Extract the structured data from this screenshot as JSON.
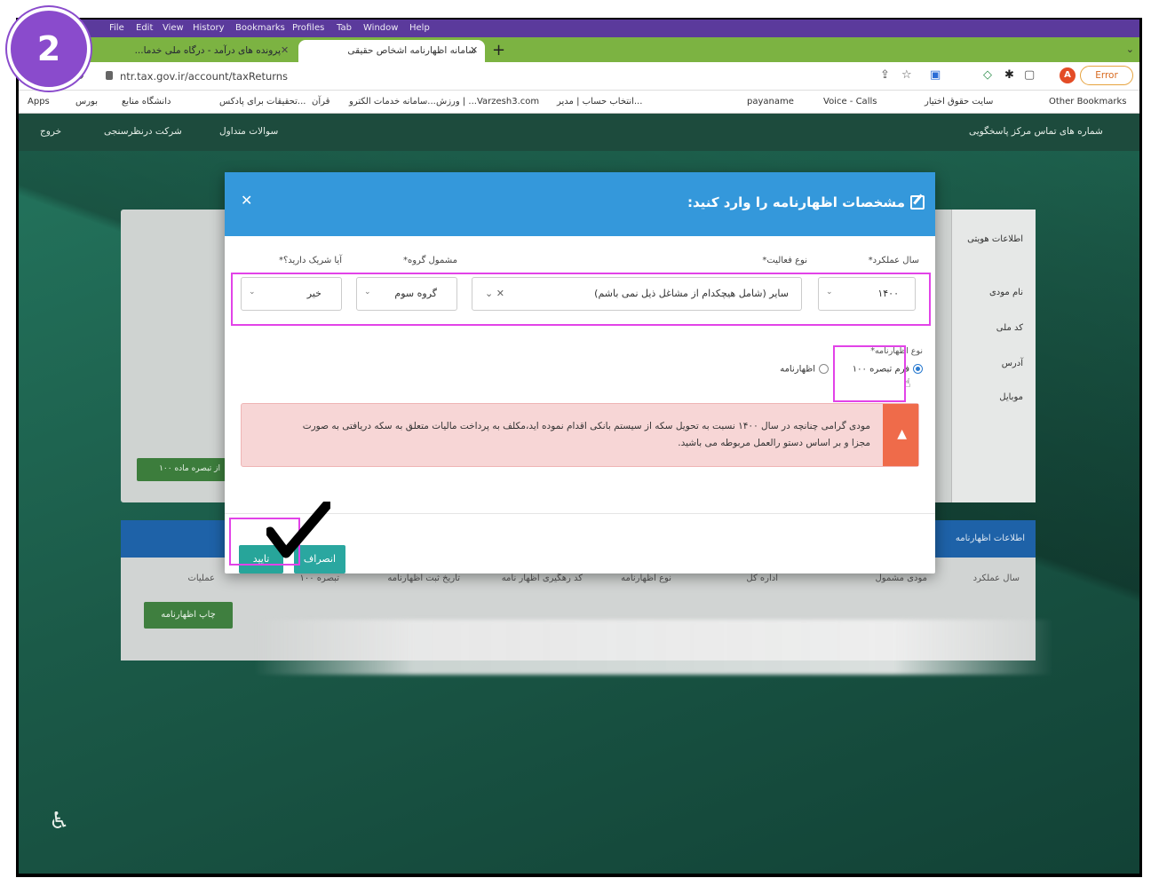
{
  "step_badge": "2",
  "menubar": {
    "items": [
      "File",
      "Edit",
      "View",
      "History",
      "Bookmarks",
      "Profiles",
      "Tab",
      "Window",
      "Help"
    ]
  },
  "tabs": [
    {
      "label": "پرونده های درآمد - درگاه ملی خدما...",
      "active": false
    },
    {
      "label": "سامانه اظهارنامه اشخاص حقیقی",
      "active": true
    }
  ],
  "address_bar": {
    "url": "ntr.tax.gov.ir/account/taxReturns",
    "error_label": "Error",
    "avatar_letter": "A"
  },
  "bookmarks": [
    "Apps",
    "بورس",
    "دانشگاه منابع",
    "تحقیقات برای پادکس...",
    "قرآن",
    "سامانه خدمات الکترو...",
    "ورزش | ...Varzesh3.com",
    "انتخاب حساب | مدیر...",
    "payaname",
    "Voice - Calls",
    "سایت حقوق اختیار",
    "Other Bookmarks"
  ],
  "site_header": {
    "exit": "خروج",
    "survey": "شرکت درنظرسنجی",
    "faq": "سوالات متداول",
    "support": "شماره های تماس مرکز پاسخگویی"
  },
  "background": {
    "side_items": [
      "اطلاعات هویتی",
      "نام مودی",
      "کد ملی",
      "آدرس",
      "موبایل"
    ],
    "green_button": "از تبصره ماده ۱۰۰",
    "declarations_header": "اطلاعات اظهارنامه",
    "columns": [
      "سال عملکرد",
      "مودی مشمول",
      "اداره کل",
      "نوع اظهارنامه",
      "کد رهگیری اظهار نامه",
      "تاریخ ثبت اظهارنامه",
      "تبصره ۱۰۰",
      "عملیات"
    ],
    "print_button": "چاپ اظهارنامه"
  },
  "modal": {
    "title": "مشخصات اظهارنامه را وارد کنید:",
    "fields": {
      "year_label": "سال عملکرد*",
      "year_value": "۱۴۰۰",
      "activity_label": "نوع فعالیت*",
      "activity_value": "سایر (شامل هیچکدام از مشاغل ذیل نمی باشم)",
      "group_label": "مشمول گروه*",
      "group_value": "گروه سوم",
      "partner_label": "آیا شریک دارید؟*",
      "partner_value": "خیر"
    },
    "type_label": "نوع اظهارنامه*",
    "radio_form": "فرم تبصره ۱۰۰",
    "radio_declaration": "اظهارنامه",
    "alert_text": "مودی گرامی چنانچه در سال ۱۴۰۰ نسبت به تحویل سکه از سیستم بانکی اقدام نموده اید،مکلف به پرداخت مالیات متعلق به سکه دریافتی به صورت مجزا و بر اساس دستو رالعمل مربوطه می باشید.",
    "confirm": "تایید",
    "cancel": "انصراف"
  },
  "colors": {
    "highlight": "#e243e8",
    "badge": "#8a4bcc",
    "modal_header": "#3498db",
    "confirm_button": "#27a59a"
  }
}
